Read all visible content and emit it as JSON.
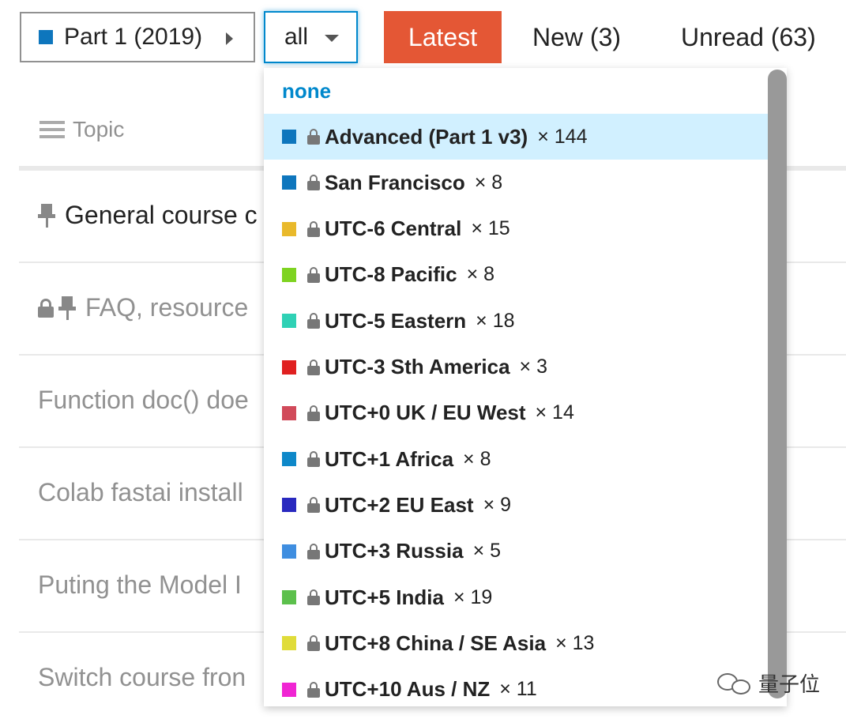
{
  "nav": {
    "category": {
      "label": "Part 1 (2019)",
      "color": "#0e76bd"
    },
    "tag_filter": {
      "label": "all"
    },
    "latest": "Latest",
    "new": "New (3)",
    "unread": "Unread (63)"
  },
  "topics": {
    "header": "Topic",
    "rows": [
      {
        "title": "General course c",
        "pinned": true,
        "locked": false,
        "dark": true
      },
      {
        "title": "FAQ, resource",
        "pinned": true,
        "locked": true,
        "dark": false
      },
      {
        "title": "Function doc() doe",
        "pinned": false,
        "locked": false,
        "dark": false
      },
      {
        "title": "Colab fastai install",
        "pinned": false,
        "locked": false,
        "dark": false
      },
      {
        "title": "Puting the Model I",
        "pinned": false,
        "locked": false,
        "dark": false
      },
      {
        "title": "Switch course fron",
        "pinned": false,
        "locked": false,
        "dark": false
      }
    ]
  },
  "dropdown": {
    "none_label": "none",
    "items": [
      {
        "name": "Advanced (Part 1 v3)",
        "count": "× 144",
        "color": "#0e76bd",
        "selected": true
      },
      {
        "name": "San Francisco",
        "count": "× 8",
        "color": "#0e76bd"
      },
      {
        "name": "UTC-6 Central",
        "count": "× 15",
        "color": "#e9b92b"
      },
      {
        "name": "UTC-8 Pacific",
        "count": "× 8",
        "color": "#7ed321"
      },
      {
        "name": "UTC-5 Eastern",
        "count": "× 18",
        "color": "#2fd1b5"
      },
      {
        "name": "UTC-3 Sth America",
        "count": "× 3",
        "color": "#e02020"
      },
      {
        "name": "UTC+0 UK / EU West",
        "count": "× 14",
        "color": "#d14a5a"
      },
      {
        "name": "UTC+1 Africa",
        "count": "× 8",
        "color": "#0e88c9"
      },
      {
        "name": "UTC+2 EU East",
        "count": "× 9",
        "color": "#2929bf"
      },
      {
        "name": "UTC+3 Russia",
        "count": "× 5",
        "color": "#3f8ee0"
      },
      {
        "name": "UTC+5 India",
        "count": "× 19",
        "color": "#5cc04c"
      },
      {
        "name": "UTC+8 China / SE Asia",
        "count": "× 13",
        "color": "#e0dc3a"
      },
      {
        "name": "UTC+10 Aus / NZ",
        "count": "× 11",
        "color": "#f025d3"
      }
    ]
  },
  "watermark": {
    "text": "量子位"
  }
}
